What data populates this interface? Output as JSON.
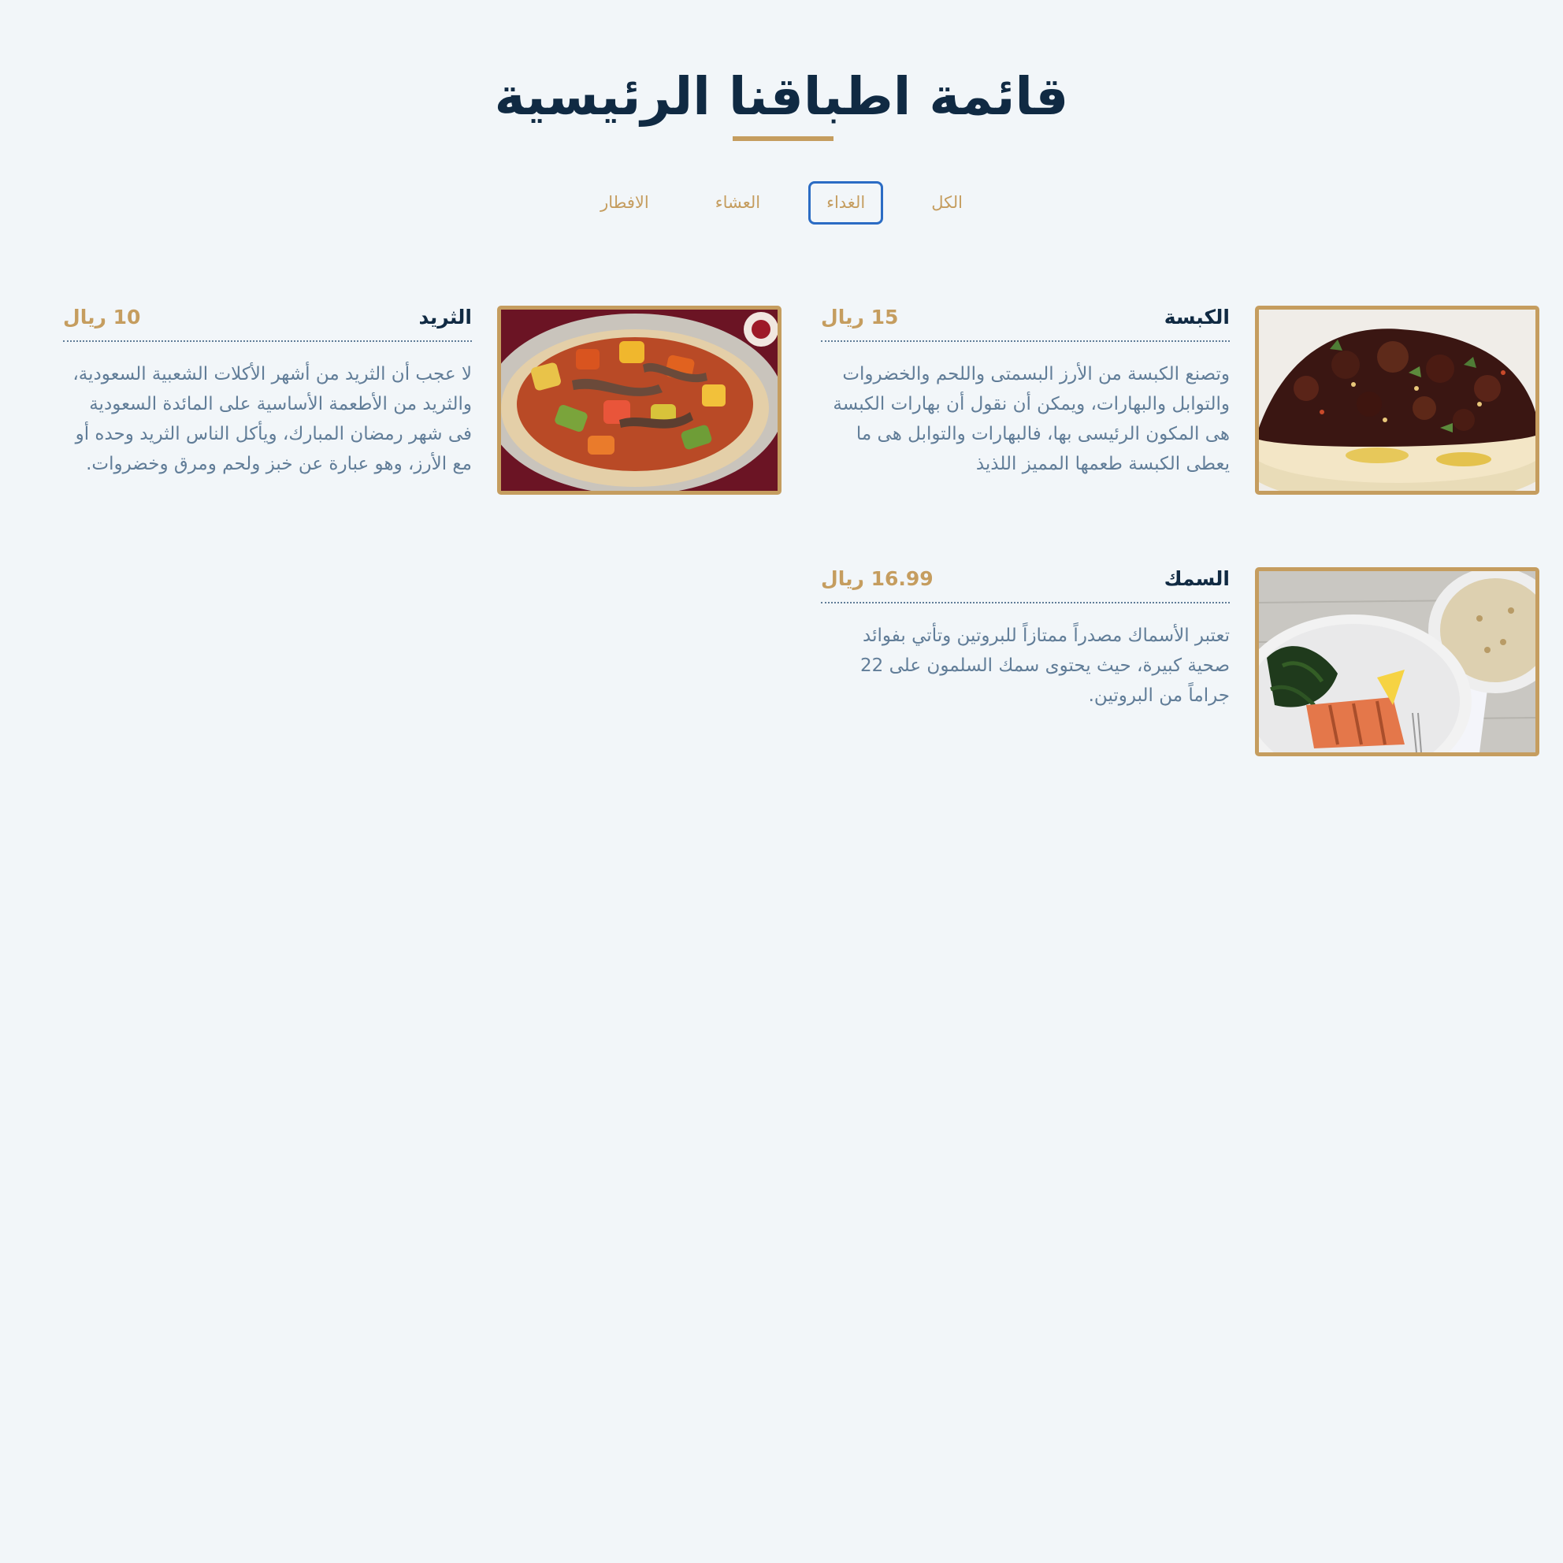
{
  "page": {
    "title": "قائمة اطباقنا الرئيسية"
  },
  "filters": {
    "all": "الكل",
    "lunch": "الغداء",
    "dinner": "العشاء",
    "breakfast": "الافطار",
    "active": "lunch"
  },
  "menu": {
    "items": [
      {
        "name": "الكبسة",
        "price": "15 ريال",
        "description": "وتصنع الكبسة من الأرز البسمتى واللحم والخضروات والتوابل والبهارات، ويمكن أن نقول أن بهارات الكبسة هى المكون الرئيسى بها، فالبهارات والتوابل هى ما يعطى الكبسة طعمها المميز اللذيذ",
        "image": "kabsa-photo"
      },
      {
        "name": "الثريد",
        "price": "10 ريال",
        "description": "لا عجب أن الثريد من أشهر الأكلات الشعبية السعودية، والثريد من الأطعمة الأساسية على المائدة السعودية فى شهر رمضان المبارك، ويأكل الناس الثريد وحده أو مع الأرز، وهو عبارة عن خبز ولحم ومرق وخضروات.",
        "image": "tharid-photo"
      },
      {
        "name": "السمك",
        "price": "16.99 ريال",
        "description": "تعتبر الأسماك مصدراً ممتازاً للبروتين وتأتي بفوائد صحية كبيرة، حيث يحتوى سمك السلمون على 22 جراماً من البروتين.",
        "image": "fish-photo"
      }
    ]
  },
  "colors": {
    "background": "#f2f6f9",
    "accent": "#c59d5f",
    "heading": "#102a43",
    "text": "#617d98",
    "active_tab_border": "#2b6cc4"
  }
}
